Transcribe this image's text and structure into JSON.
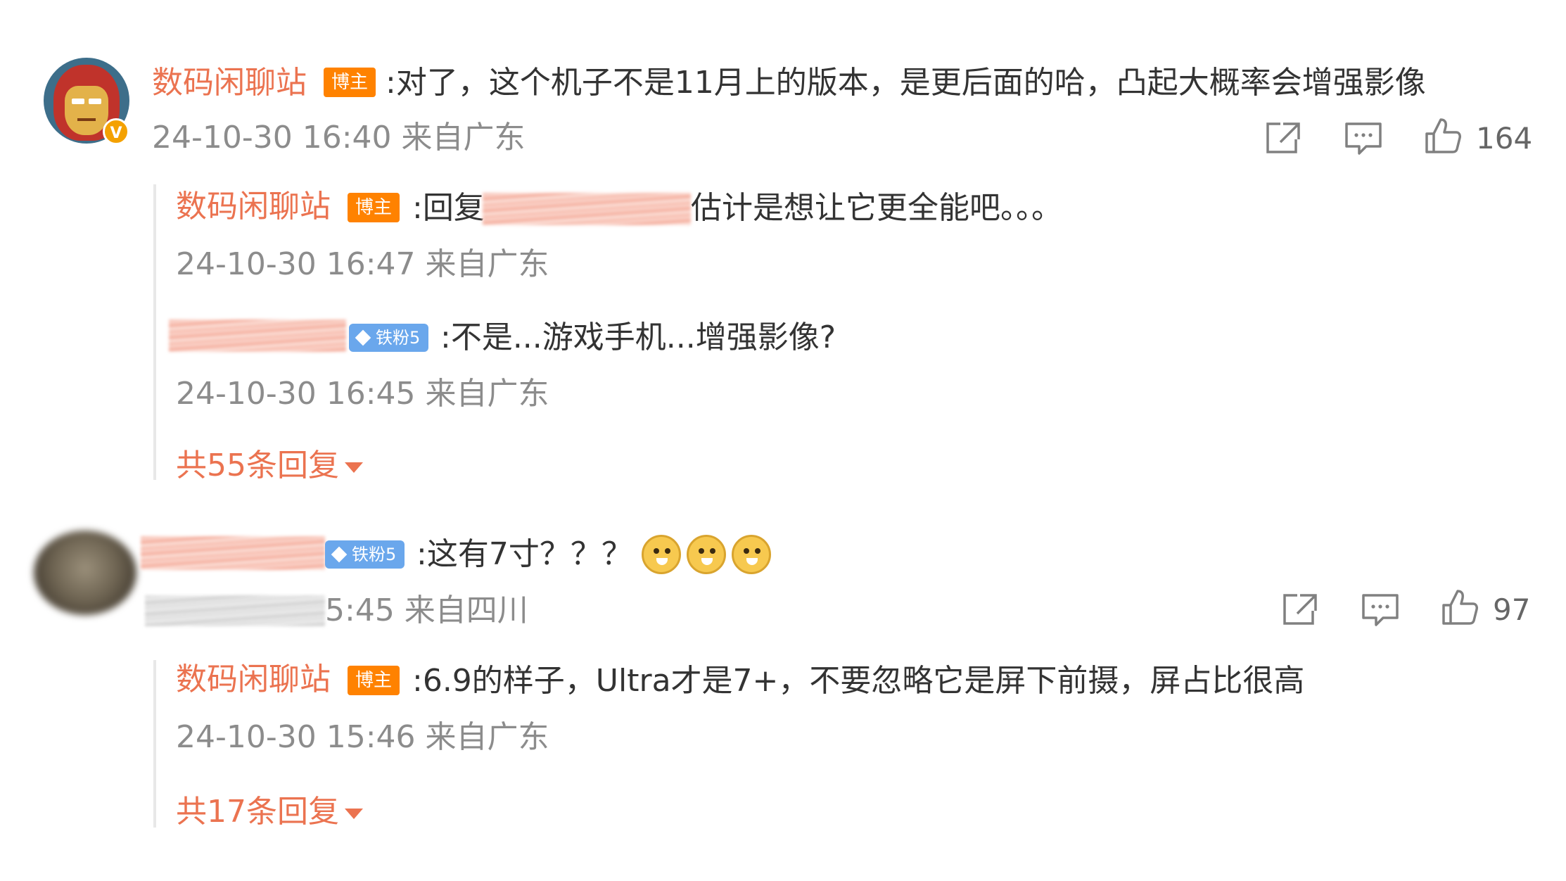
{
  "comment1": {
    "author": "数码闲聊站",
    "author_badge": "博主",
    "verified_badge": "V",
    "text": ":对了，这个机子不是11月上的版本，是更后面的哈，凸起大概率会增强影像",
    "meta": "24-10-30 16:40 来自广东",
    "like_count": "164",
    "replies": [
      {
        "author": "数码闲聊站",
        "author_badge": "博主",
        "text_before": ":回复",
        "text_after": "估计是想让它更全能吧。。。",
        "meta": "24-10-30 16:47 来自广东"
      },
      {
        "fan_badge": "铁粉5",
        "text": ":不是...游戏手机...增强影像?",
        "meta": "24-10-30 16:45 来自广东"
      }
    ],
    "more_replies": "共55条回复"
  },
  "comment2": {
    "fan_badge": "铁粉5",
    "text": ":这有7寸？？？",
    "meta_visible": "5:45 来自四川",
    "like_count": "97",
    "replies": [
      {
        "author": "数码闲聊站",
        "author_badge": "博主",
        "text": ":6.9的样子，Ultra才是7+，不要忽略它是屏下前摄，屏占比很高",
        "meta": "24-10-30 15:46 来自广东"
      }
    ],
    "more_replies": "共17条回复"
  },
  "icons": {
    "share": "share-icon",
    "comment": "comment-icon",
    "like": "thumbs-up-icon",
    "emoji": "doge-emoji-icon"
  },
  "colors": {
    "username": "#eb7350",
    "blogger_badge": "#ff8200",
    "fan_badge": "#6aa7ec",
    "meta_text": "#8c8c8c",
    "body_text": "#333333"
  }
}
